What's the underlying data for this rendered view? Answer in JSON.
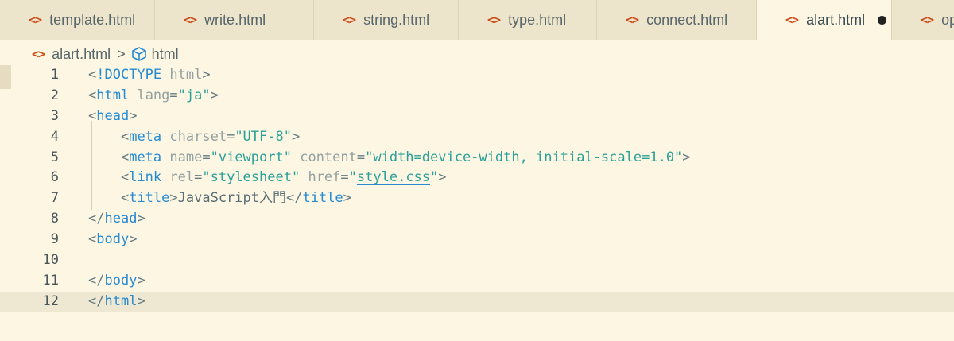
{
  "tabs": [
    {
      "label": "template.html",
      "active": false,
      "width": 195
    },
    {
      "label": "write.html",
      "active": false,
      "width": 200
    },
    {
      "label": "string.html",
      "active": false,
      "width": 182
    },
    {
      "label": "type.html",
      "active": false,
      "width": 174
    },
    {
      "label": "connect.html",
      "active": false,
      "width": 201
    },
    {
      "label": "alart.html",
      "active": true,
      "modified": true,
      "width": 170
    },
    {
      "label": "ope",
      "active": false,
      "width": 100
    }
  ],
  "tab_icon": "<>",
  "breadcrumb": {
    "file": "alart.html",
    "separator": ">",
    "symbol": "html",
    "symbol_icon": "cube-icon"
  },
  "editor": {
    "current_line": 12,
    "lines": [
      {
        "n": "1",
        "text": "<!DOCTYPE html>"
      },
      {
        "n": "2",
        "text": "<html lang=\"ja\">"
      },
      {
        "n": "3",
        "text": "<head>"
      },
      {
        "n": "4",
        "text": "    <meta charset=\"UTF-8\">"
      },
      {
        "n": "5",
        "text": "    <meta name=\"viewport\" content=\"width=device-width, initial-scale=1.0\">"
      },
      {
        "n": "6",
        "text": "    <link rel=\"stylesheet\" href=\"style.css\">"
      },
      {
        "n": "7",
        "text": "    <title>JavaScript入門</title>"
      },
      {
        "n": "8",
        "text": "</head>"
      },
      {
        "n": "9",
        "text": "<body>"
      },
      {
        "n": "10",
        "text": ""
      },
      {
        "n": "11",
        "text": "</body>"
      },
      {
        "n": "12",
        "text": "</html>"
      }
    ]
  },
  "colors": {
    "background": "#fdf6e3",
    "tab_bar": "#ede4cc",
    "icon_accent": "#cb4b16",
    "tag": "#268bd2",
    "attribute": "#93a1a1",
    "string": "#2aa198"
  }
}
